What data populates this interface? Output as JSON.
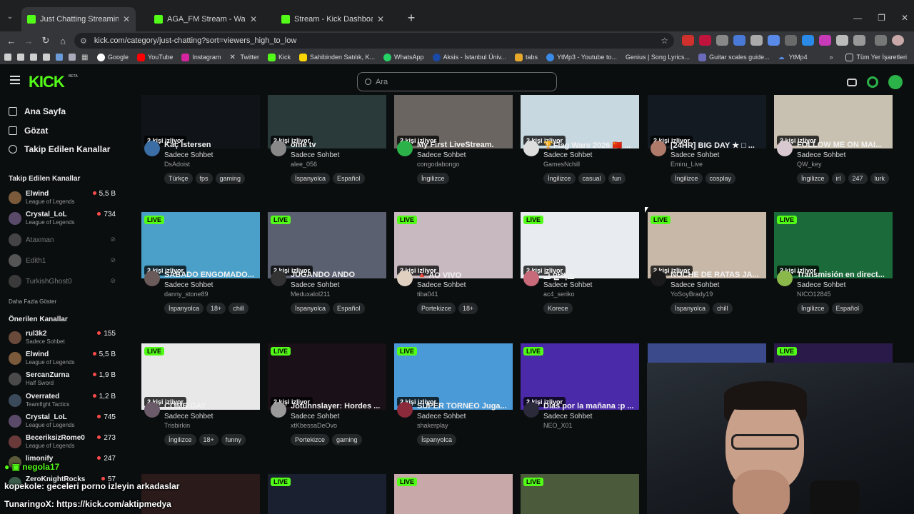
{
  "browser": {
    "tabs": [
      {
        "title": "Just Chatting Streaming - Live S",
        "active": true
      },
      {
        "title": "AGA_FM Stream - Watch Live o",
        "active": false
      },
      {
        "title": "Stream - Kick Dashboard",
        "active": false
      }
    ],
    "url": "kick.com/category/just-chatting?sort=viewers_high_to_low",
    "bookmarks": [
      "Google",
      "YouTube",
      "Instagram",
      "Twitter",
      "Kick",
      "Sahibinden Satılık, K...",
      "WhatsApp",
      "Aksis - İstanbul Üniv...",
      "tabs",
      "YtMp3 - Youtube to...",
      "Genius | Song Lyrics...",
      "Guitar scales guide...",
      "YtMp4"
    ],
    "bookmarks_right": "Tüm Yer İşaretleri"
  },
  "header": {
    "logo": "KICK",
    "beta": "BETA",
    "search_placeholder": "Ara"
  },
  "sidebar": {
    "nav": [
      {
        "label": "Ana Sayfa",
        "icon": "home-icon"
      },
      {
        "label": "Gözat",
        "icon": "browse-icon"
      },
      {
        "label": "Takip Edilen Kanallar",
        "icon": "heart-icon"
      }
    ],
    "followed_title": "Takip Edilen Kanallar",
    "followed": [
      {
        "name": "Elwind",
        "game": "League of Legends",
        "viewers": "5,5 B",
        "online": true,
        "color": "#7a5a3a"
      },
      {
        "name": "Crystal_LoL",
        "game": "League of Legends",
        "viewers": "734",
        "online": true,
        "color": "#5a4a6a"
      },
      {
        "name": "Ataxman",
        "game": "",
        "viewers": "",
        "online": false,
        "color": "#444"
      },
      {
        "name": "Edith1",
        "game": "",
        "viewers": "",
        "online": false,
        "color": "#555"
      },
      {
        "name": "TurkishGhost0",
        "game": "",
        "viewers": "",
        "online": false,
        "color": "#3a3a3a"
      }
    ],
    "show_more": "Daha Fazla Göster",
    "recommended_title": "Önerilen Kanallar",
    "recommended": [
      {
        "name": "rul3k2",
        "game": "Sadece Sohbet",
        "viewers": "155",
        "color": "#6a4a3a"
      },
      {
        "name": "Elwind",
        "game": "League of Legends",
        "viewers": "5,5 B",
        "color": "#7a5a3a"
      },
      {
        "name": "SercanZurna",
        "game": "Half Sword",
        "viewers": "1,9 B",
        "color": "#4a4a4a"
      },
      {
        "name": "Overrated",
        "game": "Teamfight Tactics",
        "viewers": "1,2 B",
        "color": "#3a4a5a"
      },
      {
        "name": "Crystal_LoL",
        "game": "League of Legends",
        "viewers": "745",
        "color": "#5a4a6a"
      },
      {
        "name": "BeceriksizRome0",
        "game": "League of Legends",
        "viewers": "273",
        "color": "#6a3a3a"
      },
      {
        "name": "limonify",
        "game": "",
        "viewers": "247",
        "color": "#5a5a3a"
      },
      {
        "name": "ZeroKnightRocks",
        "game": "",
        "viewers": "57",
        "color": "#3a5a4a"
      }
    ]
  },
  "streams": [
    {
      "title": "Kaç İstersen",
      "category": "Sadece Sohbet",
      "user": "DsAdoist",
      "viewers": "2 kişi izliyor",
      "live": false,
      "tags": [
        "Türkçe",
        "fps",
        "gaming"
      ],
      "thumb": "#101418",
      "av": "#3a6ea5"
    },
    {
      "title": "ome tv",
      "category": "Sadece Sohbet",
      "user": "alee_056",
      "viewers": "2 kişi izliyor",
      "live": false,
      "tags": [
        "İspanyolca",
        "Español"
      ],
      "thumb": "#2a3a3a",
      "av": "#888"
    },
    {
      "title": "My First LiveStream.",
      "category": "Sadece Sohbet",
      "user": "congodabongo",
      "viewers": "2 kişi izliyor",
      "live": false,
      "tags": [
        "İngilizce"
      ],
      "thumb": "#6a6560",
      "av": "#2bb34a"
    },
    {
      "title": "🏆Flag Wars 2026 🇨🇳 ...",
      "category": "Sadece Sohbet",
      "user": "GamesNchill",
      "viewers": "2 kişi izliyor",
      "live": false,
      "tags": [
        "İngilizce",
        "casual",
        "fun"
      ],
      "thumb": "#c8d8e0",
      "av": "#dddddd"
    },
    {
      "title": "[24HR] BIG DAY ★ □ ...",
      "category": "Sadece Sohbet",
      "user": "Emiru_Live",
      "viewers": "2 kişi izliyor",
      "live": false,
      "tags": [
        "İngilizce",
        "cosplay"
      ],
      "thumb": "#141a22",
      "av": "#b07a6a"
    },
    {
      "title": "FOLLOW ME ON MAI...",
      "category": "Sadece Sohbet",
      "user": "QW_key",
      "viewers": "2 kişi izliyor",
      "live": false,
      "tags": [
        "İngilizce",
        "irl",
        "247",
        "lurk"
      ],
      "thumb": "#c8c0b0",
      "av": "#d8c8d0"
    },
    {
      "title": "SABADO ENGOMADO...",
      "category": "Sadece Sohbet",
      "user": "danny_stone89",
      "viewers": "2 kişi izliyor",
      "live": true,
      "tags": [
        "İspanyolca",
        "18+",
        "chill"
      ],
      "thumb": "#4aa0c8",
      "av": "#6a5a5a"
    },
    {
      "title": "JUGANDO ANDO",
      "category": "Sadece Sohbet",
      "user": "Meduxalol211",
      "viewers": "2 kişi izliyor",
      "live": true,
      "tags": [
        "İspanyolca",
        "Español"
      ],
      "thumb": "#5a6070",
      "av": "#333"
    },
    {
      "title": "🔺 AO VIVO",
      "category": "Sadece Sohbet",
      "user": "tiba041",
      "viewers": "2 kişi izliyor",
      "live": true,
      "tags": [
        "Portekizce",
        "18+"
      ],
      "thumb": "#c8b8c0",
      "av": "#e0d0c0"
    },
    {
      "title": "고 알렉스",
      "category": "Sadece Sohbet",
      "user": "ac4_seriko",
      "viewers": "2 kişi izliyor",
      "live": true,
      "tags": [
        "Korece"
      ],
      "thumb": "#e8ecf0",
      "av": "#c86a7a"
    },
    {
      "title": "NOCHE DE RATAS JA...",
      "category": "Sadece Sohbet",
      "user": "YoSoyBrady19",
      "viewers": "2 kişi izliyor",
      "live": true,
      "tags": [
        "İspanyolca",
        "chill"
      ],
      "thumb": "#c8b8a8",
      "av": "#1a1a1a"
    },
    {
      "title": "Transmisión en direct...",
      "category": "Sadece Sohbet",
      "user": "NICO12845",
      "viewers": "2 kişi izliyor",
      "live": true,
      "tags": [
        "İngilizce",
        "Español"
      ],
      "thumb": "#1a6a3a",
      "av": "#8ab84a"
    },
    {
      "title": "COMB DAY",
      "category": "Sadece Sohbet",
      "user": "Trisbirkin",
      "viewers": "2 kişi izliyor",
      "live": true,
      "tags": [
        "İngilizce",
        "18+",
        "funny"
      ],
      "thumb": "#e8e8e8",
      "av": "#6a5a6a"
    },
    {
      "title": "Jotunnslayer: Hordes ...",
      "category": "Sadece Sohbet",
      "user": "xtKbessaDeOvo",
      "viewers": "2 kişi izliyor",
      "live": true,
      "tags": [
        "Portekizce",
        "gaming"
      ],
      "thumb": "#1a1018",
      "av": "#9a9a9a"
    },
    {
      "title": "SUPER TORNEO Juga...",
      "category": "Sadece Sohbet",
      "user": "shakerplay",
      "viewers": "2 kişi izliyor",
      "live": true,
      "tags": [
        "İspanyolca"
      ],
      "thumb": "#4a9ad8",
      "av": "#8a2a3a"
    },
    {
      "title": "Días por la mañana :p ...",
      "category": "Sadece Sohbet",
      "user": "NEO_X01",
      "viewers": "2 kişi izliyor",
      "live": true,
      "tags": [],
      "thumb": "#4a2aa8",
      "av": "#2a2a3a"
    },
    {
      "title": "",
      "category": "",
      "user": "",
      "viewers": "",
      "live": false,
      "tags": [],
      "thumb": "#3a4a8a",
      "av": "#333"
    },
    {
      "title": "",
      "category": "",
      "user": "",
      "viewers": "",
      "live": true,
      "tags": [],
      "thumb": "#2a1a4a",
      "av": "#333"
    }
  ],
  "bottom_row": [
    {
      "live": false,
      "thumb": "#2a1a1a"
    },
    {
      "live": true,
      "thumb": "#1a2030"
    },
    {
      "live": true,
      "thumb": "#c8a8a8"
    },
    {
      "live": true,
      "thumb": "#4a5a3a"
    }
  ],
  "overlay_chat": [
    {
      "user": "negola17",
      "text": ""
    },
    {
      "user": "kopekole",
      "text": ": geceleri porno izleyin arkadaslar"
    },
    {
      "user": "TunaringoX",
      "text": ": https://kick.com/aktipmedya"
    }
  ],
  "colors": {
    "accent": "#53fc18",
    "bg": "#0b0e0f",
    "tag_bg": "#25282a"
  }
}
